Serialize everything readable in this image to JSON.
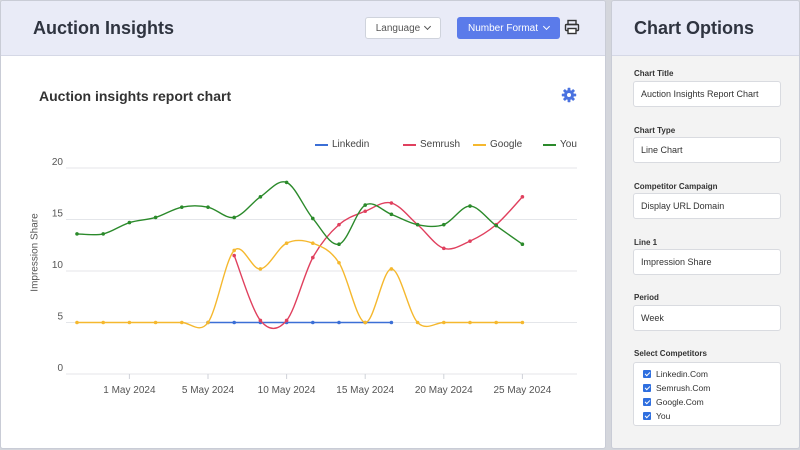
{
  "header": {
    "title": "Auction Insights",
    "language_label": "Language",
    "number_format_label": "Number Format"
  },
  "chart_card": {
    "title": "Auction insights report chart"
  },
  "side_panel": {
    "title": "Chart Options",
    "fields": [
      {
        "label": "Chart Title",
        "value": "Auction Insights Report Chart"
      },
      {
        "label": "Chart Type",
        "value": "Line Chart"
      },
      {
        "label": "Competitor Campaign",
        "value": "Display URL Domain"
      },
      {
        "label": "Line 1",
        "value": "Impression Share"
      },
      {
        "label": "Period",
        "value": "Week"
      }
    ],
    "competitors_label": "Select Competitors",
    "competitors": [
      {
        "label": "Linkedin.Com",
        "checked": true
      },
      {
        "label": "Semrush.Com",
        "checked": true
      },
      {
        "label": "Google.Com",
        "checked": true
      },
      {
        "label": "You",
        "checked": true
      }
    ]
  },
  "chart_data": {
    "type": "line",
    "ylabel": "Impression Share",
    "xlabel": "",
    "ylim": [
      0,
      20
    ],
    "yticks": [
      0,
      5,
      10,
      15,
      20
    ],
    "x_tick_labels": [
      "1 May 2024",
      "5 May 2024",
      "10 May 2024",
      "15 May 2024",
      "20 May 2024",
      "25 May 2024"
    ],
    "x_tick_positions": [
      2,
      5,
      8,
      11,
      14,
      17
    ],
    "legend_position": "top",
    "grid": true,
    "series": [
      {
        "name": "Linkedin",
        "color": "#3b6fd6",
        "x": [
          5,
          6,
          7,
          8,
          9,
          10,
          11,
          12
        ],
        "y": [
          5,
          5,
          5,
          5,
          5,
          5,
          5,
          5
        ]
      },
      {
        "name": "Semrush",
        "color": "#e0405e",
        "x": [
          6,
          7,
          8,
          9,
          10,
          11,
          12,
          13,
          14,
          15,
          16,
          17
        ],
        "y": [
          11.5,
          5.2,
          5.2,
          11.3,
          14.5,
          15.8,
          16.6,
          14.5,
          12.2,
          12.9,
          14.5,
          17.2
        ]
      },
      {
        "name": "Google",
        "color": "#f5b82e",
        "x": [
          0,
          1,
          2,
          3,
          4,
          5,
          6,
          7,
          8,
          9,
          10,
          11,
          12,
          13,
          14,
          15,
          16,
          17
        ],
        "y": [
          5,
          5,
          5,
          5,
          5,
          5,
          12,
          10.2,
          12.7,
          12.7,
          10.8,
          5,
          10.2,
          5,
          5,
          5,
          5,
          5
        ]
      },
      {
        "name": "You",
        "color": "#2b8a2b",
        "x": [
          0,
          1,
          2,
          3,
          4,
          5,
          6,
          7,
          8,
          9,
          10,
          11,
          12,
          13,
          14,
          15,
          16,
          17
        ],
        "y": [
          13.6,
          13.6,
          14.7,
          15.2,
          16.2,
          16.2,
          15.2,
          17.2,
          18.6,
          15.1,
          12.6,
          16.4,
          15.5,
          14.5,
          14.5,
          16.3,
          14.4,
          12.6
        ]
      }
    ]
  }
}
